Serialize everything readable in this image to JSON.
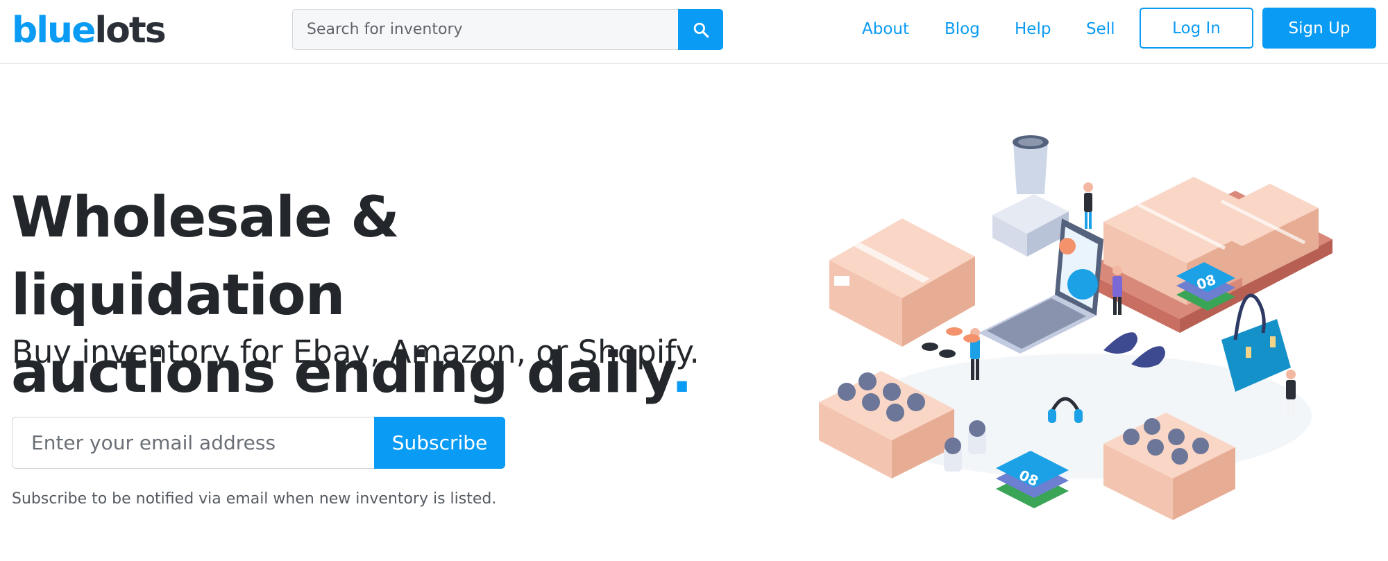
{
  "header": {
    "logo_part1": "blue",
    "logo_part2": "lots",
    "search_placeholder": "Search for inventory",
    "search_icon": "search-icon",
    "nav": [
      {
        "label": "About"
      },
      {
        "label": "Blog"
      },
      {
        "label": "Help"
      },
      {
        "label": "Sell"
      }
    ],
    "login_label": "Log In",
    "signup_label": "Sign Up"
  },
  "hero": {
    "title_line1": "Wholesale & liquidation",
    "title_line2": "auctions ending daily",
    "title_dot": ".",
    "subtitle": "Buy inventory for Ebay, Amazon, or Shopify.",
    "email_placeholder": "Enter your email address",
    "subscribe_label": "Subscribe",
    "hint": "Subscribe to be notified via email when new inventory is listed.",
    "illustration_labels": {
      "shirt_number_1": "08",
      "shirt_number_2": "08"
    }
  },
  "colors": {
    "accent": "#0a9bf4",
    "text_dark": "#23272b",
    "box": "#f3c5b0",
    "box_shade": "#e5ab92"
  }
}
